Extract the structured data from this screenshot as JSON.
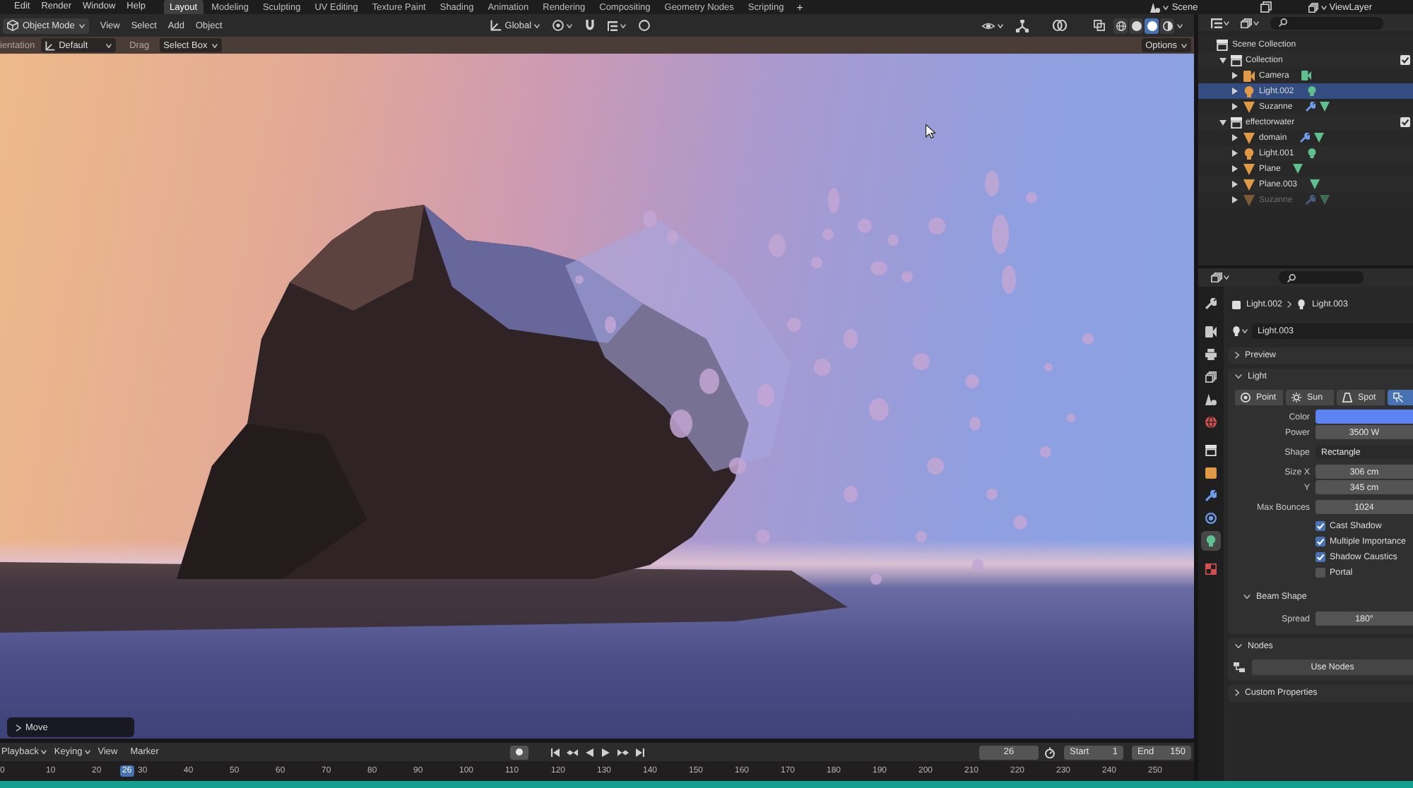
{
  "top_bar": {
    "menus": [
      "Edit",
      "Render",
      "Window",
      "Help"
    ],
    "workspaces": [
      {
        "label": "Layout",
        "selected": true
      },
      {
        "label": "Modeling",
        "selected": false
      },
      {
        "label": "Sculpting",
        "selected": false
      },
      {
        "label": "UV Editing",
        "selected": false
      },
      {
        "label": "Texture Paint",
        "selected": false
      },
      {
        "label": "Shading",
        "selected": false
      },
      {
        "label": "Animation",
        "selected": false
      },
      {
        "label": "Rendering",
        "selected": false
      },
      {
        "label": "Compositing",
        "selected": false
      },
      {
        "label": "Geometry Nodes",
        "selected": false
      },
      {
        "label": "Scripting",
        "selected": false
      }
    ],
    "add_workspace": "+",
    "scene": "Scene",
    "view_layer": "ViewLayer"
  },
  "viewport_header": {
    "mode": "Object Mode",
    "menus": [
      "View",
      "Select",
      "Add",
      "Object"
    ],
    "orientation": "Global",
    "shading_modes": [
      {
        "kind": "wireframe",
        "selected": false
      },
      {
        "kind": "solid",
        "selected": false
      },
      {
        "kind": "material",
        "selected": true
      },
      {
        "kind": "rendered",
        "selected": false
      }
    ]
  },
  "tool_settings": {
    "orientation_label": "ientation",
    "orientation": "Default",
    "drag_label": "Drag",
    "drag": "Select Box",
    "options": "Options"
  },
  "viewport": {
    "last_operator": {
      "label": "Move",
      "expanded": false
    }
  },
  "timeline": {
    "menus": [
      {
        "label": "Playback",
        "dropdown": true
      },
      {
        "label": "Keying",
        "dropdown": true
      },
      {
        "label": "View",
        "dropdown": false
      },
      {
        "label": "Marker",
        "dropdown": false
      }
    ],
    "current_frame": "26",
    "start_label": "Start",
    "start": "1",
    "end_label": "End",
    "end": "150",
    "ruler": [
      {
        "label": "0",
        "selected": false
      },
      {
        "label": "10",
        "selected": false
      },
      {
        "label": "20",
        "selected": false
      },
      {
        "label": "26",
        "selected": true
      },
      {
        "label": "30",
        "selected": false
      },
      {
        "label": "40",
        "selected": false
      },
      {
        "label": "50",
        "selected": false
      },
      {
        "label": "60",
        "selected": false
      },
      {
        "label": "70",
        "selected": false
      },
      {
        "label": "80",
        "selected": false
      },
      {
        "label": "90",
        "selected": false
      },
      {
        "label": "100",
        "selected": false
      },
      {
        "label": "110",
        "selected": false
      },
      {
        "label": "120",
        "selected": false
      },
      {
        "label": "130",
        "selected": false
      },
      {
        "label": "140",
        "selected": false
      },
      {
        "label": "150",
        "selected": false
      },
      {
        "label": "160",
        "selected": false
      },
      {
        "label": "170",
        "selected": false
      },
      {
        "label": "180",
        "selected": false
      },
      {
        "label": "190",
        "selected": false
      },
      {
        "label": "200",
        "selected": false
      },
      {
        "label": "210",
        "selected": false
      },
      {
        "label": "220",
        "selected": false
      },
      {
        "label": "230",
        "selected": false
      },
      {
        "label": "240",
        "selected": false
      },
      {
        "label": "250",
        "selected": false
      }
    ]
  },
  "outliner": {
    "tree": [
      {
        "label": "Scene Collection",
        "kind": "scene",
        "selected": false,
        "children": [
          {
            "label": "Collection",
            "kind": "collection",
            "selected": false,
            "expanded": true,
            "children": [
              {
                "label": "Camera",
                "kind": "camera",
                "selected": false,
                "expanded": false,
                "modifiers": false,
                "hidden": false
              },
              {
                "label": "Light.002",
                "kind": "light",
                "selected": true,
                "expanded": false,
                "modifiers": false,
                "hidden": false
              },
              {
                "label": "Suzanne",
                "kind": "mesh",
                "selected": false,
                "expanded": false,
                "modifiers": true,
                "hidden": false
              }
            ]
          },
          {
            "label": "effectorwater",
            "kind": "collection",
            "selected": false,
            "expanded": true,
            "children": [
              {
                "label": "domain",
                "kind": "mesh",
                "selected": false,
                "expanded": false,
                "modifiers": true,
                "hidden": false
              },
              {
                "label": "Light.001",
                "kind": "light",
                "selected": false,
                "expanded": false,
                "modifiers": false,
                "hidden": false
              },
              {
                "label": "Plane",
                "kind": "mesh",
                "selected": false,
                "expanded": false,
                "modifiers": false,
                "hidden": false
              },
              {
                "label": "Plane.003",
                "kind": "mesh",
                "selected": false,
                "expanded": false,
                "modifiers": false,
                "hidden": false
              },
              {
                "label": "Suzanne",
                "kind": "mesh",
                "selected": false,
                "expanded": false,
                "modifiers": true,
                "hidden": true
              }
            ]
          }
        ]
      }
    ]
  },
  "properties": {
    "tabs": [
      {
        "kind": "tool",
        "selected": false
      },
      {
        "kind": "render",
        "selected": false
      },
      {
        "kind": "output",
        "selected": false
      },
      {
        "kind": "view_layer",
        "selected": false
      },
      {
        "kind": "scene",
        "selected": false
      },
      {
        "kind": "world",
        "selected": false
      },
      {
        "kind": "collection",
        "selected": false
      },
      {
        "kind": "object",
        "selected": false
      },
      {
        "kind": "modifiers",
        "selected": false
      },
      {
        "kind": "physics",
        "selected": false
      },
      {
        "kind": "data",
        "selected": true
      },
      {
        "kind": "texture",
        "selected": false
      }
    ],
    "breadcrumb": [
      "Light.002",
      "Light.003"
    ],
    "datablock": "Light.003",
    "panels": [
      {
        "kind": "plain",
        "title": "Preview",
        "expanded": false
      },
      {
        "kind": "light",
        "title": "Light",
        "expanded": true,
        "light_types": [
          {
            "kind": "point",
            "label": "Point",
            "selected": false
          },
          {
            "kind": "sun",
            "label": "Sun",
            "selected": false
          },
          {
            "kind": "spot",
            "label": "Spot",
            "selected": false
          },
          {
            "kind": "area",
            "selected": true
          }
        ],
        "field_groups": [
          {
            "fields": [
              {
                "kind": "color",
                "label": "Color",
                "color": "#5b83f2"
              },
              {
                "kind": "number",
                "label": "Power",
                "value": "3500 W"
              }
            ]
          },
          {
            "fields": [
              {
                "kind": "dropdown",
                "label": "Shape",
                "value": "Rectangle"
              }
            ]
          },
          {
            "fields": [
              {
                "kind": "number",
                "label": "Size X",
                "value": "306 cm"
              },
              {
                "kind": "number",
                "label": "Y",
                "value": "345 cm"
              }
            ]
          },
          {
            "fields": [
              {
                "kind": "number",
                "label": "Max Bounces",
                "value": "1024"
              }
            ]
          }
        ],
        "checkboxes": [
          {
            "label": "Cast Shadow",
            "checked": true
          },
          {
            "label": "Multiple Importance",
            "checked": true
          },
          {
            "label": "Shadow Caustics",
            "checked": true
          },
          {
            "label": "Portal",
            "checked": false
          }
        ],
        "subpanel": {
          "title": "Beam Shape",
          "expanded": true,
          "fields": [
            {
              "kind": "number",
              "label": "Spread",
              "value": "180°"
            }
          ]
        }
      },
      {
        "kind": "nodes",
        "title": "Nodes",
        "expanded": true,
        "button": "Use Nodes"
      },
      {
        "kind": "plain",
        "title": "Custom Properties",
        "expanded": false
      }
    ]
  }
}
